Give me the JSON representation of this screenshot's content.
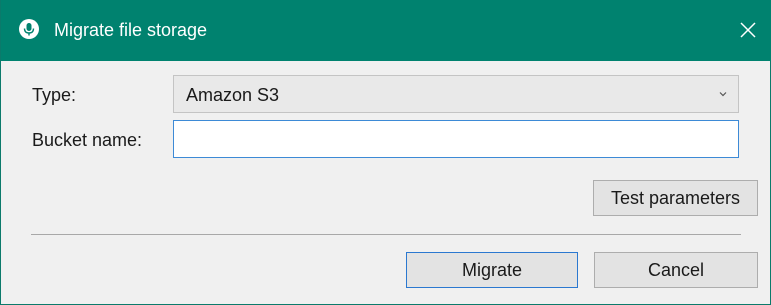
{
  "window": {
    "title": "Migrate file storage",
    "app_icon": "microphone-icon",
    "close_icon": "close-icon",
    "accent_color": "#00826f"
  },
  "form": {
    "type_label": "Type:",
    "type_value": "Amazon S3",
    "bucket_label": "Bucket name:",
    "bucket_value": ""
  },
  "buttons": {
    "test": "Test parameters",
    "migrate": "Migrate",
    "cancel": "Cancel"
  }
}
